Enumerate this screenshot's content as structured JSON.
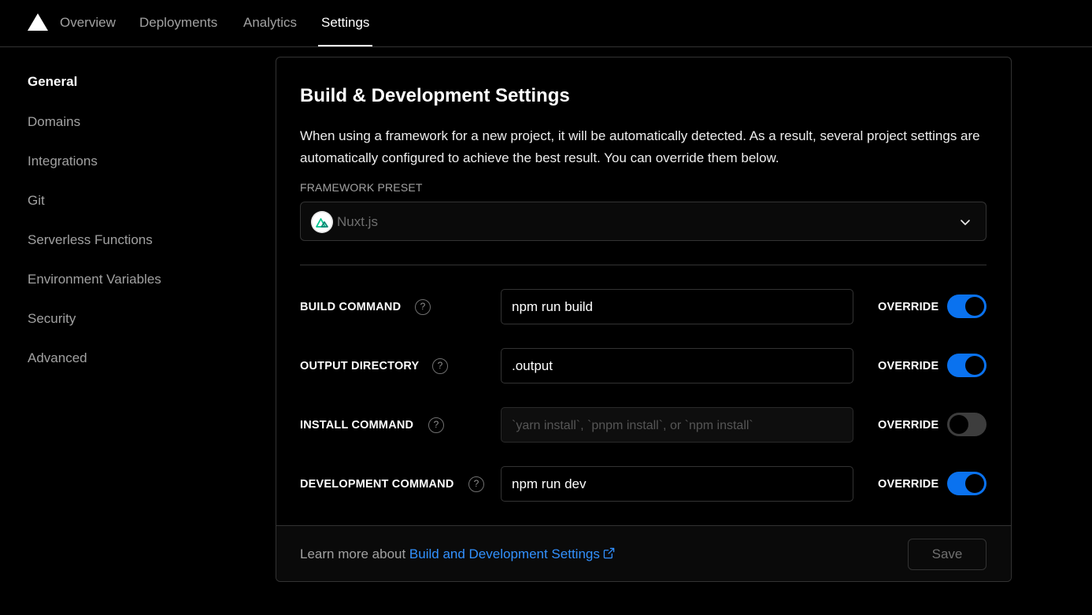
{
  "nav": {
    "tabs": [
      {
        "label": "Overview"
      },
      {
        "label": "Deployments"
      },
      {
        "label": "Analytics"
      },
      {
        "label": "Settings",
        "active": true
      }
    ]
  },
  "sidebar": {
    "items": [
      {
        "label": "General",
        "active": true
      },
      {
        "label": "Domains"
      },
      {
        "label": "Integrations"
      },
      {
        "label": "Git"
      },
      {
        "label": "Serverless Functions"
      },
      {
        "label": "Environment Variables"
      },
      {
        "label": "Security"
      },
      {
        "label": "Advanced"
      }
    ]
  },
  "card": {
    "title": "Build & Development Settings",
    "description": "When using a framework for a new project, it will be automatically detected. As a result, several project settings are automatically configured to achieve the best result. You can override them below.",
    "preset_label": "FRAMEWORK PRESET",
    "preset_value": "Nuxt.js",
    "rows": [
      {
        "label": "BUILD COMMAND",
        "value": "npm run build",
        "placeholder": "",
        "override_label": "OVERRIDE",
        "override": true
      },
      {
        "label": "OUTPUT DIRECTORY",
        "value": ".output",
        "placeholder": "",
        "override_label": "OVERRIDE",
        "override": true
      },
      {
        "label": "INSTALL COMMAND",
        "value": "",
        "placeholder": "`yarn install`, `pnpm install`, or `npm install`",
        "override_label": "OVERRIDE",
        "override": false
      },
      {
        "label": "DEVELOPMENT COMMAND",
        "value": "npm run dev",
        "placeholder": "",
        "override_label": "OVERRIDE",
        "override": true
      }
    ],
    "footer": {
      "learn_prefix": "Learn more about ",
      "learn_link": "Build and Development Settings",
      "save_label": "Save"
    }
  },
  "colors": {
    "background": "#000000",
    "accent": "#0a72ef",
    "link": "#3291ff",
    "border": "#333333"
  },
  "icons": [
    "vercel-logo-icon",
    "nuxt-logo-icon",
    "chevron-down-icon",
    "help-icon",
    "external-link-icon"
  ]
}
